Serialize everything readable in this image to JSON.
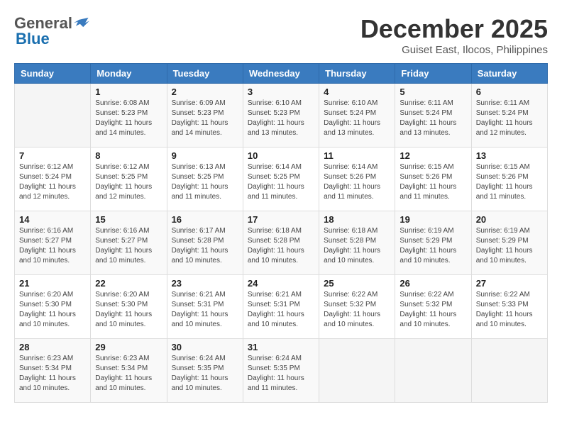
{
  "logo": {
    "general": "General",
    "blue": "Blue"
  },
  "title": "December 2025",
  "location": "Guiset East, Ilocos, Philippines",
  "headers": [
    "Sunday",
    "Monday",
    "Tuesday",
    "Wednesday",
    "Thursday",
    "Friday",
    "Saturday"
  ],
  "weeks": [
    [
      {
        "day": "",
        "info": ""
      },
      {
        "day": "1",
        "info": "Sunrise: 6:08 AM\nSunset: 5:23 PM\nDaylight: 11 hours\nand 14 minutes."
      },
      {
        "day": "2",
        "info": "Sunrise: 6:09 AM\nSunset: 5:23 PM\nDaylight: 11 hours\nand 14 minutes."
      },
      {
        "day": "3",
        "info": "Sunrise: 6:10 AM\nSunset: 5:23 PM\nDaylight: 11 hours\nand 13 minutes."
      },
      {
        "day": "4",
        "info": "Sunrise: 6:10 AM\nSunset: 5:24 PM\nDaylight: 11 hours\nand 13 minutes."
      },
      {
        "day": "5",
        "info": "Sunrise: 6:11 AM\nSunset: 5:24 PM\nDaylight: 11 hours\nand 13 minutes."
      },
      {
        "day": "6",
        "info": "Sunrise: 6:11 AM\nSunset: 5:24 PM\nDaylight: 11 hours\nand 12 minutes."
      }
    ],
    [
      {
        "day": "7",
        "info": "Sunrise: 6:12 AM\nSunset: 5:24 PM\nDaylight: 11 hours\nand 12 minutes."
      },
      {
        "day": "8",
        "info": "Sunrise: 6:12 AM\nSunset: 5:25 PM\nDaylight: 11 hours\nand 12 minutes."
      },
      {
        "day": "9",
        "info": "Sunrise: 6:13 AM\nSunset: 5:25 PM\nDaylight: 11 hours\nand 11 minutes."
      },
      {
        "day": "10",
        "info": "Sunrise: 6:14 AM\nSunset: 5:25 PM\nDaylight: 11 hours\nand 11 minutes."
      },
      {
        "day": "11",
        "info": "Sunrise: 6:14 AM\nSunset: 5:26 PM\nDaylight: 11 hours\nand 11 minutes."
      },
      {
        "day": "12",
        "info": "Sunrise: 6:15 AM\nSunset: 5:26 PM\nDaylight: 11 hours\nand 11 minutes."
      },
      {
        "day": "13",
        "info": "Sunrise: 6:15 AM\nSunset: 5:26 PM\nDaylight: 11 hours\nand 11 minutes."
      }
    ],
    [
      {
        "day": "14",
        "info": "Sunrise: 6:16 AM\nSunset: 5:27 PM\nDaylight: 11 hours\nand 10 minutes."
      },
      {
        "day": "15",
        "info": "Sunrise: 6:16 AM\nSunset: 5:27 PM\nDaylight: 11 hours\nand 10 minutes."
      },
      {
        "day": "16",
        "info": "Sunrise: 6:17 AM\nSunset: 5:28 PM\nDaylight: 11 hours\nand 10 minutes."
      },
      {
        "day": "17",
        "info": "Sunrise: 6:18 AM\nSunset: 5:28 PM\nDaylight: 11 hours\nand 10 minutes."
      },
      {
        "day": "18",
        "info": "Sunrise: 6:18 AM\nSunset: 5:28 PM\nDaylight: 11 hours\nand 10 minutes."
      },
      {
        "day": "19",
        "info": "Sunrise: 6:19 AM\nSunset: 5:29 PM\nDaylight: 11 hours\nand 10 minutes."
      },
      {
        "day": "20",
        "info": "Sunrise: 6:19 AM\nSunset: 5:29 PM\nDaylight: 11 hours\nand 10 minutes."
      }
    ],
    [
      {
        "day": "21",
        "info": "Sunrise: 6:20 AM\nSunset: 5:30 PM\nDaylight: 11 hours\nand 10 minutes."
      },
      {
        "day": "22",
        "info": "Sunrise: 6:20 AM\nSunset: 5:30 PM\nDaylight: 11 hours\nand 10 minutes."
      },
      {
        "day": "23",
        "info": "Sunrise: 6:21 AM\nSunset: 5:31 PM\nDaylight: 11 hours\nand 10 minutes."
      },
      {
        "day": "24",
        "info": "Sunrise: 6:21 AM\nSunset: 5:31 PM\nDaylight: 11 hours\nand 10 minutes."
      },
      {
        "day": "25",
        "info": "Sunrise: 6:22 AM\nSunset: 5:32 PM\nDaylight: 11 hours\nand 10 minutes."
      },
      {
        "day": "26",
        "info": "Sunrise: 6:22 AM\nSunset: 5:32 PM\nDaylight: 11 hours\nand 10 minutes."
      },
      {
        "day": "27",
        "info": "Sunrise: 6:22 AM\nSunset: 5:33 PM\nDaylight: 11 hours\nand 10 minutes."
      }
    ],
    [
      {
        "day": "28",
        "info": "Sunrise: 6:23 AM\nSunset: 5:34 PM\nDaylight: 11 hours\nand 10 minutes."
      },
      {
        "day": "29",
        "info": "Sunrise: 6:23 AM\nSunset: 5:34 PM\nDaylight: 11 hours\nand 10 minutes."
      },
      {
        "day": "30",
        "info": "Sunrise: 6:24 AM\nSunset: 5:35 PM\nDaylight: 11 hours\nand 10 minutes."
      },
      {
        "day": "31",
        "info": "Sunrise: 6:24 AM\nSunset: 5:35 PM\nDaylight: 11 hours\nand 11 minutes."
      },
      {
        "day": "",
        "info": ""
      },
      {
        "day": "",
        "info": ""
      },
      {
        "day": "",
        "info": ""
      }
    ]
  ]
}
